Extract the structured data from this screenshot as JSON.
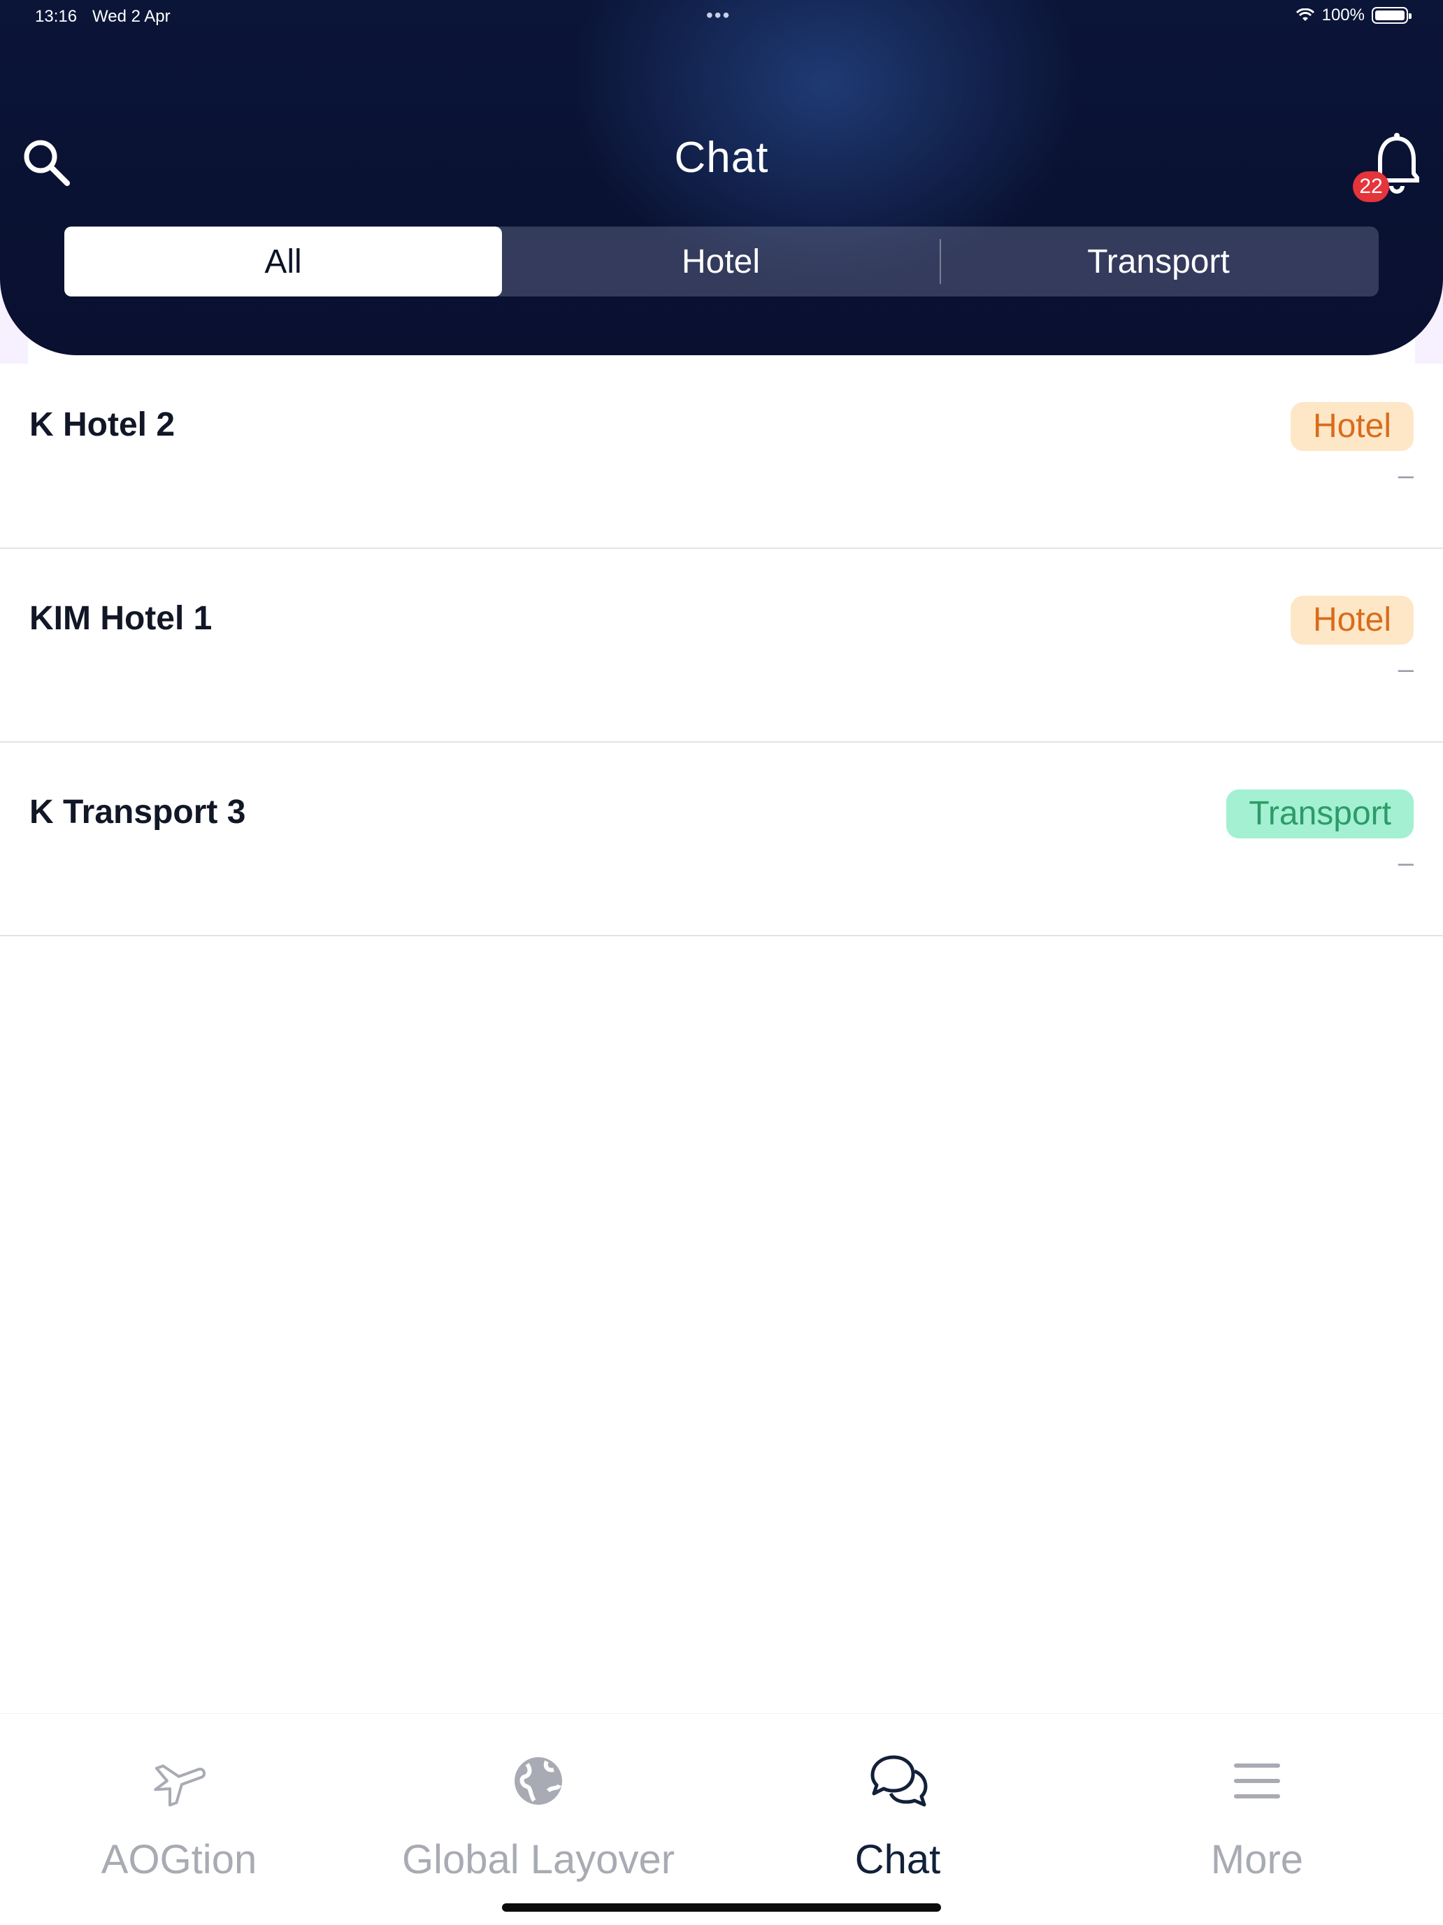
{
  "status_bar": {
    "time": "13:16",
    "date": "Wed 2 Apr",
    "battery": "100%"
  },
  "header": {
    "title": "Chat",
    "notification_count": "22"
  },
  "filters": {
    "tabs": [
      "All",
      "Hotel",
      "Transport"
    ],
    "selected": "All"
  },
  "chats": [
    {
      "name": "K Hotel 2",
      "category": "Hotel",
      "meta": "–"
    },
    {
      "name": "KIM Hotel 1",
      "category": "Hotel",
      "meta": "–"
    },
    {
      "name": "K Transport 3",
      "category": "Transport",
      "meta": "–"
    }
  ],
  "tabbar": {
    "items": [
      {
        "label": "AOGtion",
        "icon": "plane-icon"
      },
      {
        "label": "Global Layover",
        "icon": "globe-icon"
      },
      {
        "label": "Chat",
        "icon": "chat-bubbles-icon"
      },
      {
        "label": "More",
        "icon": "menu-icon"
      }
    ],
    "active": "Chat"
  },
  "colors": {
    "header_bg": "#0b1538",
    "hotel_badge_bg": "#fde7c7",
    "hotel_badge_text": "#d96c1c",
    "transport_badge_bg": "#a3f0d3",
    "transport_badge_text": "#2d9b68",
    "notification_badge": "#e5343a"
  }
}
